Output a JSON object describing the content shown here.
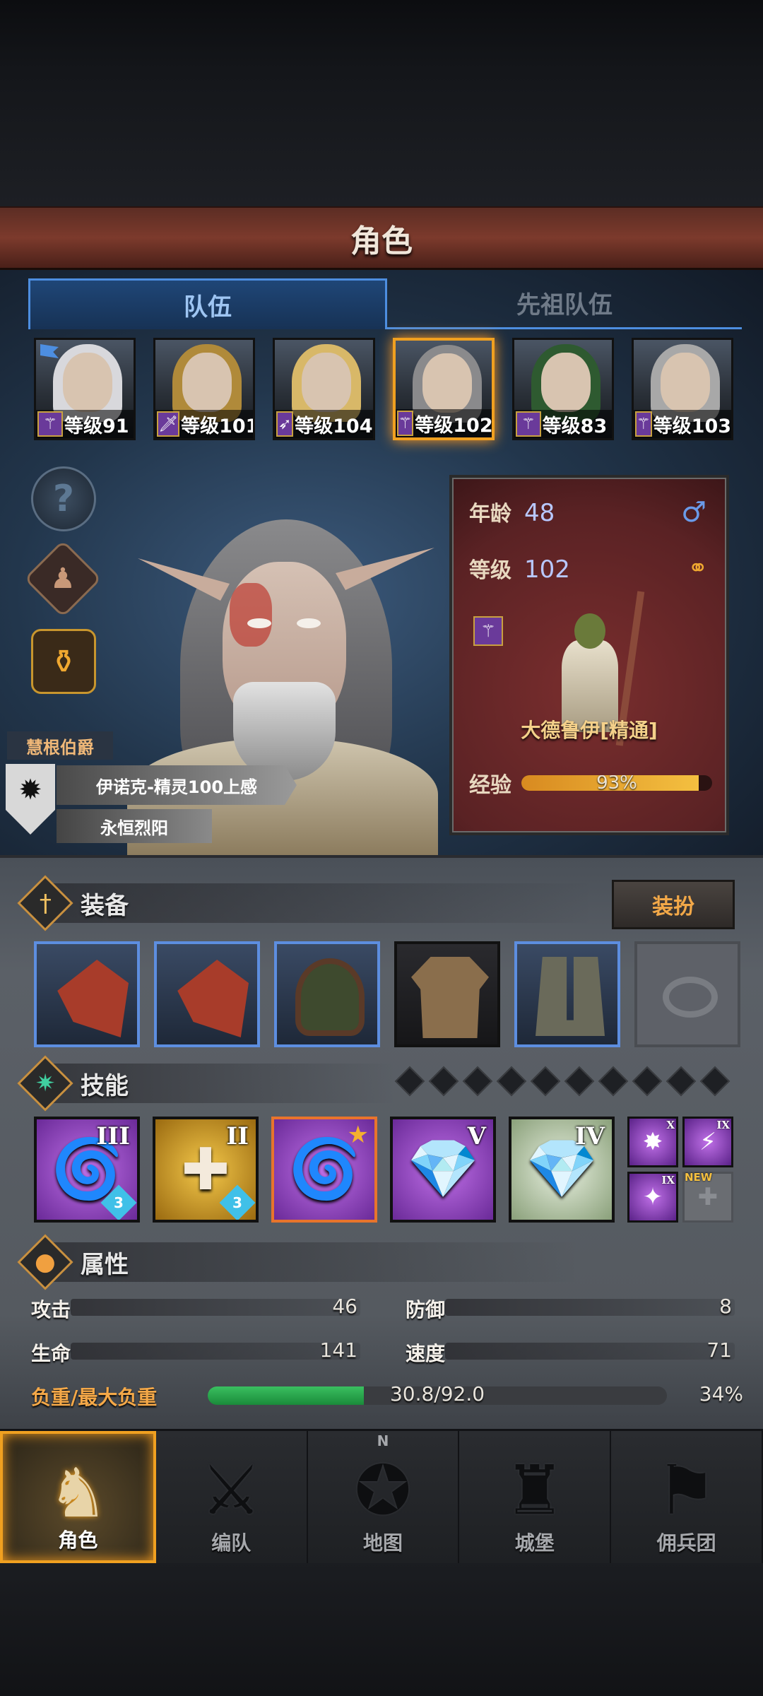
{
  "header": {
    "title": "角色"
  },
  "tabs": [
    {
      "label": "队伍",
      "active": true
    },
    {
      "label": "先祖队伍",
      "active": false
    }
  ],
  "roster": [
    {
      "level_text": "等级91",
      "class_icon": "staff-icon",
      "hair_color": "#d8d8dc",
      "selected": false
    },
    {
      "level_text": "等级101",
      "class_icon": "sword-icon",
      "hair_color": "#b08a3a",
      "selected": false
    },
    {
      "level_text": "等级104",
      "class_icon": "bow-icon",
      "hair_color": "#d8b868",
      "selected": false
    },
    {
      "level_text": "等级102",
      "class_icon": "staff-icon",
      "hair_color": "#8a8a8c",
      "selected": true
    },
    {
      "level_text": "等级83",
      "class_icon": "staff-icon",
      "hair_color": "#2e5a30",
      "selected": false
    },
    {
      "level_text": "等级103",
      "class_icon": "staff-icon",
      "hair_color": "#a8a8a8",
      "selected": false
    }
  ],
  "side_buttons": {
    "help": "?",
    "character": "♟",
    "potion": "⚱"
  },
  "character": {
    "title": "慧根伯爵",
    "name": "伊诺克-精灵100上感",
    "subtitle": "永恒烈阳",
    "age_label": "年龄",
    "age": "48",
    "gender_symbol": "♂",
    "level_label": "等级",
    "level": "102",
    "class_name": "大德鲁伊[精通]",
    "exp_label": "经验",
    "exp_percent_text": "93%",
    "exp_fraction": 0.93
  },
  "equipment": {
    "title": "装备",
    "dress_button": "装扮",
    "slots": [
      {
        "item": "claw",
        "rarity": "blue"
      },
      {
        "item": "claw",
        "rarity": "blue"
      },
      {
        "item": "hood",
        "rarity": "blue"
      },
      {
        "item": "tunic",
        "rarity": "dark"
      },
      {
        "item": "boots",
        "rarity": "blue"
      },
      {
        "item": "ring",
        "rarity": "empty"
      }
    ]
  },
  "skills": {
    "title": "技能",
    "pip_count": 10,
    "main": [
      {
        "rank": "III",
        "color": "purple",
        "glyph": "🌀",
        "gem": "3"
      },
      {
        "rank": "II",
        "color": "gold",
        "glyph": "✚",
        "gem": "3"
      },
      {
        "rank": "★",
        "color": "purple",
        "glyph": "🌀",
        "starred": true
      },
      {
        "rank": "V",
        "color": "purple",
        "glyph": "💎"
      },
      {
        "rank": "IV",
        "color": "white",
        "glyph": "💎"
      }
    ],
    "mini": [
      {
        "rank": "X",
        "glyph": "✸"
      },
      {
        "rank": "IX",
        "glyph": "⚡"
      },
      {
        "rank": "IX",
        "glyph": "✦"
      },
      {
        "new_label": "NEW",
        "glyph": "✚",
        "empty": true
      }
    ]
  },
  "attributes": {
    "title": "属性",
    "attack_label": "攻击",
    "attack": "46",
    "defense_label": "防御",
    "defense": "8",
    "hp_label": "生命",
    "hp": "141",
    "speed_label": "速度",
    "speed": "71",
    "load_label": "负重/最大负重",
    "load_text": "30.8/92.0",
    "load_percent": "34%",
    "load_fraction": 0.34
  },
  "nav": [
    {
      "label": "角色",
      "icon": "knight-icon",
      "glyph": "♞",
      "active": true
    },
    {
      "label": "编队",
      "icon": "formation-icon",
      "glyph": "⚔",
      "active": false
    },
    {
      "label": "地图",
      "icon": "map-compass-icon",
      "glyph": "✪",
      "active": false,
      "compass": "N"
    },
    {
      "label": "城堡",
      "icon": "castle-icon",
      "glyph": "♜",
      "active": false
    },
    {
      "label": "佣兵团",
      "icon": "mercenary-icon",
      "glyph": "⚑",
      "active": false
    }
  ]
}
